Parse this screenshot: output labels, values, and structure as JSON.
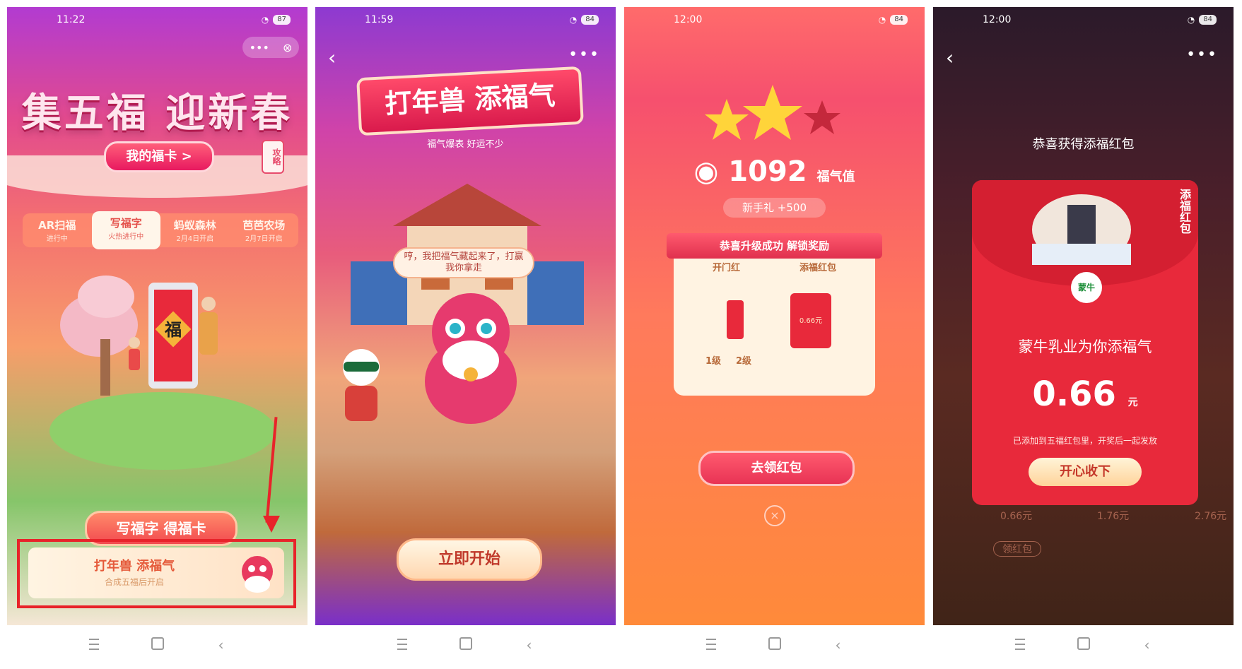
{
  "screens": [
    {
      "time": "11:22",
      "battery": "87"
    },
    {
      "time": "11:59",
      "battery": "84"
    },
    {
      "time": "12:00",
      "battery": "84"
    },
    {
      "time": "12:00",
      "battery": "84"
    }
  ],
  "s1": {
    "title": "集五福 迎新春",
    "my_cards": "我的福卡 >",
    "strategy": "攻略",
    "tabs": [
      {
        "label": "AR扫福",
        "status": "进行中"
      },
      {
        "label": "写福字",
        "status": "火热进行中"
      },
      {
        "label": "蚂蚁森林",
        "status": "2月4日开启"
      },
      {
        "label": "芭芭农场",
        "status": "2月7日开启"
      }
    ],
    "fu_char": "福",
    "write_btn": "写福字 得福卡",
    "banner_title": "打年兽 添福气",
    "banner_sub": "合成五福后开启"
  },
  "s2": {
    "title": "打年兽 添福气",
    "subtitle": "福气爆表 好运不少",
    "speech": "哼，我把福气藏起来了，打赢我你拿走",
    "start": "立即开始"
  },
  "s3": {
    "score": "1092",
    "score_unit": "福气值",
    "novice": "新手礼 +500",
    "ribbon": "恭喜升级成功 解锁奖励",
    "reward_left": "开门红",
    "reward_right": "添福红包",
    "env_amount": "0.66元",
    "level_from": "1级",
    "level_to": "2级",
    "claim": "去领红包"
  },
  "s4": {
    "congrats": "恭喜获得添福红包",
    "side_tag": "添福红包",
    "brand": "蒙牛",
    "sponsor": "蒙牛乳业为你添福气",
    "amount": "0.66",
    "unit": "元",
    "note": "已添加到五福红包里，开奖后一起发放",
    "accept": "开心收下",
    "bg_values": [
      "0.66元",
      "1.76元",
      "2.76元"
    ],
    "bg_btn": "领红包"
  }
}
